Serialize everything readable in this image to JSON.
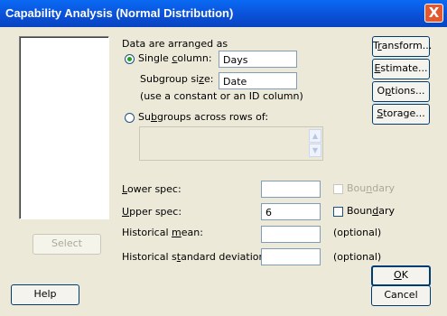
{
  "window": {
    "title": "Capability Analysis (Normal Distribution)",
    "close_glyph": "X"
  },
  "data_arranged_label": "Data are arranged as",
  "single_column": {
    "pre": "Single ",
    "accel": "c",
    "post": "olumn:",
    "value": "Days",
    "selected": true
  },
  "subgroup_size": {
    "pre": "Subgroup si",
    "accel": "z",
    "post": "e:",
    "value": "Date"
  },
  "subgroup_hint": "(use a constant or an ID column)",
  "subgroups_across": {
    "pre": "Su",
    "accel": "b",
    "post": "groups across rows of:",
    "selected": false
  },
  "lower_spec": {
    "accel": "L",
    "post": "ower spec:",
    "value": ""
  },
  "upper_spec": {
    "accel": "U",
    "post": "pper spec:",
    "value": "6"
  },
  "boundary_lower": {
    "pre": "Bou",
    "accel": "n",
    "post": "dary",
    "checked": false,
    "enabled": false
  },
  "boundary_upper": {
    "pre": "Boun",
    "accel": "d",
    "post": "ary",
    "checked": false,
    "enabled": true
  },
  "historical_mean": {
    "pre": "Historical ",
    "accel": "m",
    "post": "ean:",
    "value": "",
    "optional": "(optional)"
  },
  "historical_sd": {
    "pre": "Historical s",
    "accel": "t",
    "post": "andard deviation:",
    "value": "",
    "optional": "(optional)"
  },
  "buttons": {
    "transform": {
      "pre": "T",
      "accel": "r",
      "post": "ansform..."
    },
    "estimate": {
      "pre": "",
      "accel": "E",
      "post": "stimate..."
    },
    "options": {
      "pre": "O",
      "accel": "p",
      "post": "tions..."
    },
    "storage": {
      "pre": "",
      "accel": "S",
      "post": "torage..."
    },
    "select": "Select",
    "help": "Help",
    "ok": {
      "accel": "O",
      "post": "K"
    },
    "cancel": "Cancel"
  },
  "scroll_up_glyph": "▲",
  "scroll_down_glyph": "▼",
  "colors": {
    "title_bar": "#0a4fd6",
    "dialog_bg": "#ece9d8",
    "close_button": "#e2582f",
    "radio_dot": "#21a121"
  },
  "icons": {
    "close": "close-icon",
    "scroll_up": "scroll-up-icon",
    "scroll_down": "scroll-down-icon"
  }
}
